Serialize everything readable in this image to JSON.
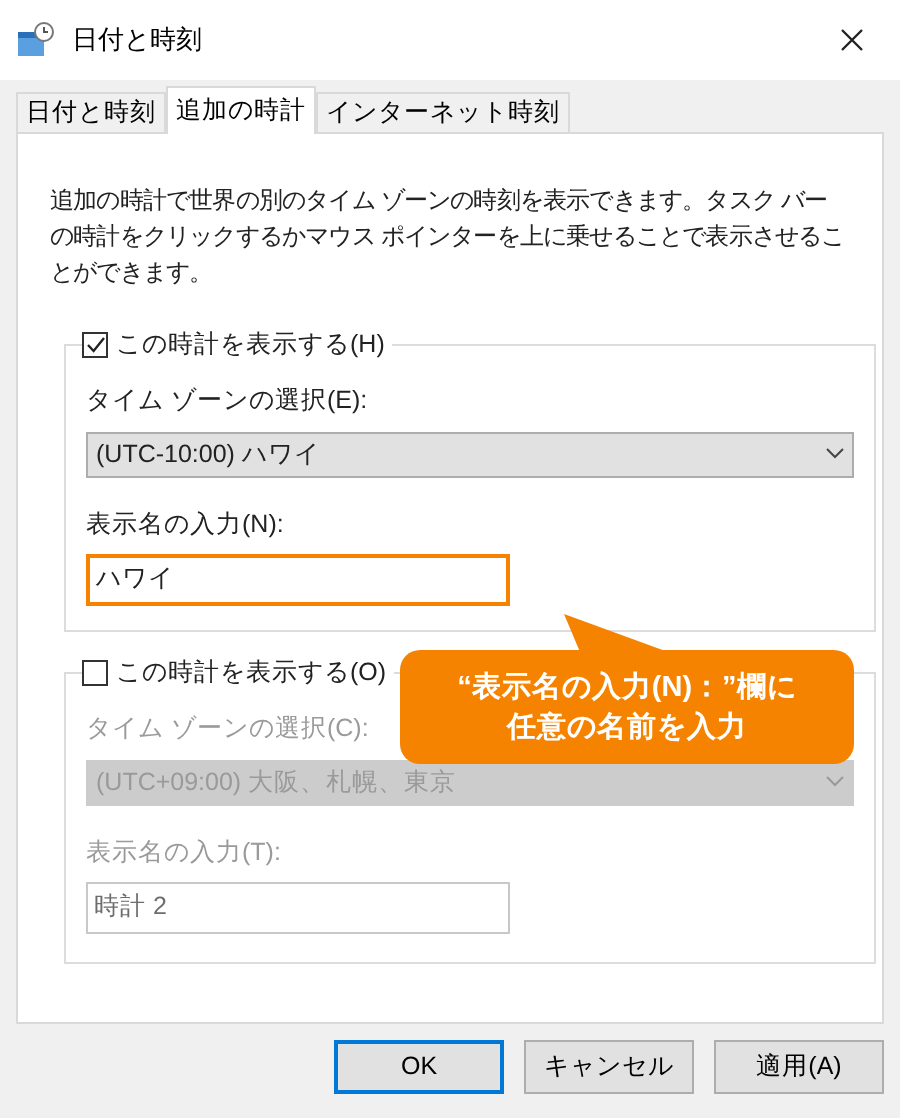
{
  "window": {
    "title": "日付と時刻"
  },
  "tabs": [
    {
      "label": "日付と時刻",
      "selected": false
    },
    {
      "label": "追加の時計",
      "selected": true
    },
    {
      "label": "インターネット時刻",
      "selected": false
    }
  ],
  "description": "追加の時計で世界の別のタイム ゾーンの時刻を表示できます。タスク バーの時計をクリックするかマウス ポインターを上に乗せることで表示させることができます。",
  "clocks": [
    {
      "show_label": "この時計を表示する(H)",
      "checked": true,
      "timezone_label": "タイム ゾーンの選択(E):",
      "timezone_value": "(UTC-10:00) ハワイ",
      "name_label": "表示名の入力(N):",
      "name_value": "ハワイ",
      "highlighted": true
    },
    {
      "show_label": "この時計を表示する(O)",
      "checked": false,
      "timezone_label": "タイム ゾーンの選択(C):",
      "timezone_value": "(UTC+09:00) 大阪、札幌、東京",
      "name_label": "表示名の入力(T):",
      "name_value": "時計 2",
      "highlighted": false
    }
  ],
  "callout": {
    "lines": [
      "“表示名の入力(N)：”欄に",
      "任意の名前を入力"
    ]
  },
  "buttons": [
    {
      "label": "OK",
      "default": true
    },
    {
      "label": "キャンセル",
      "default": false
    },
    {
      "label": "適用(A)",
      "default": false
    }
  ]
}
